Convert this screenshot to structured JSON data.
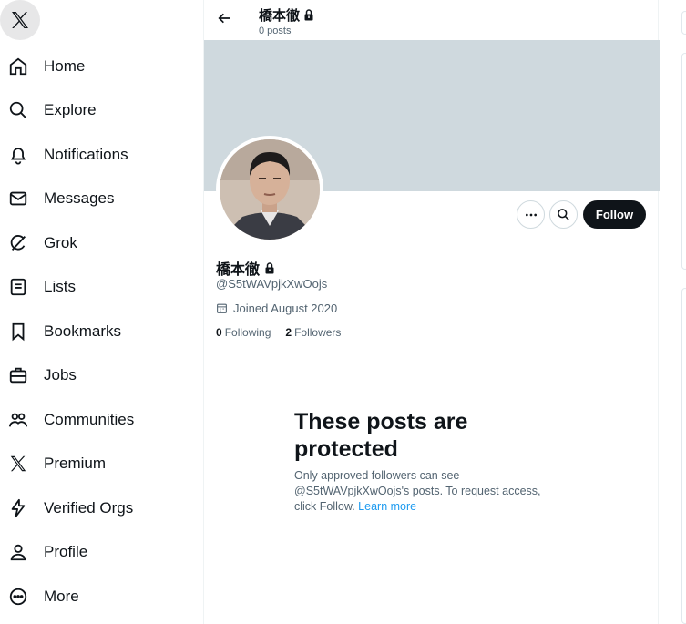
{
  "nav": {
    "items": [
      {
        "label": "Home",
        "icon": "home-icon"
      },
      {
        "label": "Explore",
        "icon": "search-icon"
      },
      {
        "label": "Notifications",
        "icon": "bell-icon"
      },
      {
        "label": "Messages",
        "icon": "envelope-icon"
      },
      {
        "label": "Grok",
        "icon": "grok-icon"
      },
      {
        "label": "Lists",
        "icon": "list-icon"
      },
      {
        "label": "Bookmarks",
        "icon": "bookmark-icon"
      },
      {
        "label": "Jobs",
        "icon": "briefcase-icon"
      },
      {
        "label": "Communities",
        "icon": "people-icon"
      },
      {
        "label": "Premium",
        "icon": "x-logo-icon"
      },
      {
        "label": "Verified Orgs",
        "icon": "lightning-icon"
      },
      {
        "label": "Profile",
        "icon": "person-icon"
      },
      {
        "label": "More",
        "icon": "more-circle-icon"
      }
    ]
  },
  "header": {
    "name": "橋本徹",
    "posts_count": "0 posts"
  },
  "profile": {
    "name": "橋本徹",
    "handle": "@S5tWAVpjkXwOojs",
    "joined": "Joined August 2020",
    "following_count": "0",
    "following_label": "Following",
    "followers_count": "2",
    "followers_label": "Followers",
    "follow_button": "Follow"
  },
  "protected": {
    "title": "These posts are protected",
    "text": "Only approved followers can see @S5tWAVpjkXwOojs's posts. To request access, click Follow.",
    "link": "Learn more"
  },
  "colors": {
    "banner": "#cfd9de",
    "link": "#1d9bf0",
    "button_dark": "#0f1419",
    "secondary_text": "#536471"
  }
}
